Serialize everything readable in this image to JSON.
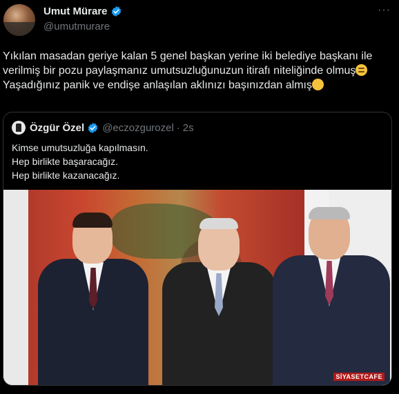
{
  "author": {
    "display_name": "Umut Mürare",
    "handle": "@umutmurare",
    "verified": true
  },
  "icons": {
    "verified": "verified-badge-icon",
    "more": "more-dots-icon"
  },
  "more_label": "···",
  "tweet": {
    "line1": "Yıkılan masadan geriye kalan 5 genel başkan yerine iki belediye başkanı ile verilmiş bir pozu paylaşmanız umutsuzluğunuzun itirafı niteliğinde olmuş",
    "line2": "Yaşadığınız panik ve endişe anlaşılan aklınızı başınızdan almış"
  },
  "quoted": {
    "display_name": "Özgür Özel",
    "handle": "@eczozgurozel",
    "separator": "·",
    "time": "2s",
    "text": "Kimse umutsuzluğa kapılmasın.\nHep birlikte başaracağız.\nHep birlikte kazanacağız."
  },
  "photo": {
    "watermark_a": "SİYASET",
    "watermark_b": "CAFE"
  },
  "colors": {
    "background": "#000000",
    "text": "#e7e9ea",
    "secondary": "#71767b",
    "verified_blue": "#1d9bf0",
    "border": "#2f3336"
  }
}
